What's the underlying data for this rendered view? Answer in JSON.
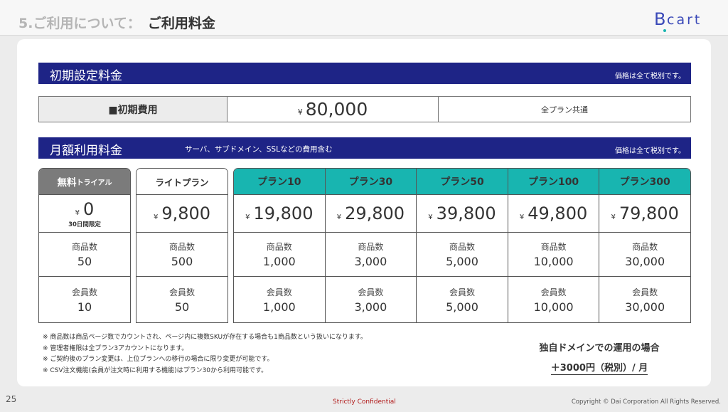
{
  "header": {
    "section_prefix": "5.ご利用について：",
    "title": "ご利用料金",
    "logo_b": "B",
    "logo_text": "cart"
  },
  "initial": {
    "band_title": "初期設定料金",
    "tax_note": "価格は全て税別です。",
    "row_label": "■初期費用",
    "yen": "¥",
    "price": "80,000",
    "note": "全プラン共通"
  },
  "monthly": {
    "band_title": "月額利用料金",
    "subtitle": "サーバ、サブドメイン、SSLなどの費用含む",
    "tax_note": "価格は全て税別です。",
    "product_label": "商品数",
    "member_label": "会員数",
    "yen": "¥"
  },
  "trial": {
    "name_big": "無料",
    "name_small": "トライアル",
    "price": "0",
    "price_sub": "30日間限定",
    "products": "50",
    "members": "10"
  },
  "lite": {
    "name": "ライトプラン",
    "price": "9,800",
    "products": "500",
    "members": "50"
  },
  "plans": [
    {
      "name": "プラン10",
      "price": "19,800",
      "products": "1,000",
      "members": "1,000"
    },
    {
      "name": "プラン30",
      "price": "29,800",
      "products": "3,000",
      "members": "3,000"
    },
    {
      "name": "プラン50",
      "price": "39,800",
      "products": "5,000",
      "members": "5,000"
    },
    {
      "name": "プラン100",
      "price": "49,800",
      "products": "10,000",
      "members": "10,000"
    },
    {
      "name": "プラン300",
      "price": "79,800",
      "products": "30,000",
      "members": "30,000"
    }
  ],
  "footnotes": [
    "※ 商品数は商品ページ数でカウントされ、ページ内に複数SKUが存在する場合も1商品数という扱いになります。",
    "※ 管理者権限は全プラン3アカウントになります。",
    "※ ご契約後のプラン変更は、上位プランへの移行の場合に限り変更が可能です。",
    "※ CSV注文機能(会員が注文時に利用する機能)はプラン30から利用可能です。"
  ],
  "domain": {
    "title": "独自ドメインでの運用の場合",
    "price": "＋3000円（税別）/ 月"
  },
  "footer": {
    "page": "25",
    "confidential": "Strictly Confidential",
    "copyright": "Copyright © Dai Corporation All Rights Reserved."
  },
  "colors": {
    "band": "#1e2486",
    "plan_header": "#18b5b0",
    "trial_header": "#7b7b7b",
    "logo": "#3a49b8"
  }
}
